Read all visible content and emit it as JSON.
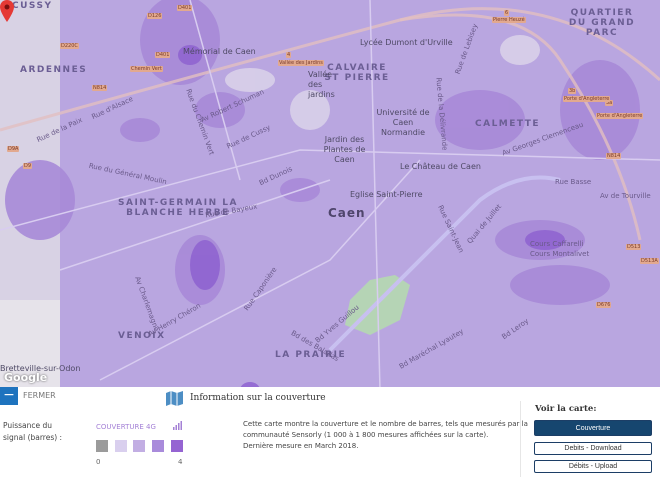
{
  "map": {
    "districts": [
      "ARDENNES",
      "CALVAIRE ST PIERRE",
      "QUARTIER DU GRAND PARC",
      "CALMETTE",
      "SAINT-GERMAIN LA BLANCHE HERBE",
      "VENOIX",
      "LA PRAIRIE",
      "CUSSY"
    ],
    "city": "Caen",
    "pois": [
      "Mémorial de Caen",
      "Lycée Dumont d'Urville",
      "Université de Caen Normandie",
      "Jardin des Plantes de Caen",
      "Le Château de Caen",
      "Eglise Saint-Pierre",
      "Vallée des jardins",
      "Bretteville-sur-Odon"
    ],
    "streets": [
      "Rue d'Alsace",
      "Rue de la Paix",
      "Rue du Général Moulin",
      "Rue du Chemin Vert",
      "Av Robert Schuman",
      "Rue de Cussy",
      "Rue de Bayeux",
      "Bd Dunois",
      "Rue de Lebisey",
      "Av Georges Clemenceau",
      "Rue de la Délivrande",
      "Cours Caffarelli",
      "Cours Montalivet",
      "Bd Yves Guillou",
      "Bd des Baladas",
      "Av Henry Chéron",
      "Rue Caponière",
      "Bd Leroy",
      "Rue Basse",
      "Av de Tourville",
      "Quai de Juillet",
      "Rue Saint-Jean",
      "Av Charlemagne",
      "Bd Maréchal Lyautey"
    ],
    "road_shields": [
      "D401",
      "D126",
      "D220C",
      "D401",
      "N814",
      "D9A",
      "D9",
      "4",
      "6",
      "3b",
      "3a",
      "N814",
      "D513",
      "D513A",
      "D676"
    ],
    "exits": [
      "Chemin Vert",
      "Vallée des Jardins",
      "Pierre Heuzé",
      "Porte d'Angleterre",
      "Porte d'Angleterre"
    ],
    "attribution": "Google"
  },
  "panel": {
    "close_label": "FERMER",
    "title": "Information sur la couverture",
    "signal_label_1": "Puissance du",
    "signal_label_2": "signal (barres) :",
    "coverage_label": "COUVERTURE 4G",
    "scale_min": "0",
    "scale_max": "4",
    "scale_colors": [
      "#9b9b9b",
      "#d9cfee",
      "#c2aee3",
      "#a98bdb",
      "#9564d2"
    ],
    "description_1": "Cette carte montre la couverture et le nombre de barres, tels que mesurés par la",
    "description_2": "communauté Sensorly (1 000 à 1 800 mesures affichées sur la carte).",
    "description_3": "Dernière mesure en March 2018.",
    "view_label": "Voir la carte:",
    "buttons": [
      "Couverture",
      "Debits - Download",
      "Débits - Upload"
    ]
  }
}
